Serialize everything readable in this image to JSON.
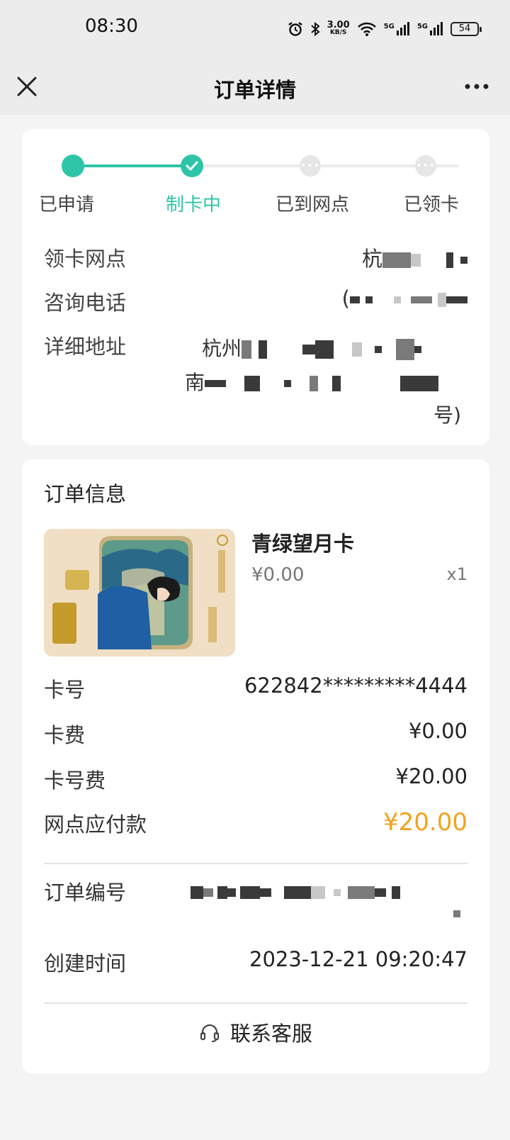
{
  "status": {
    "time": "08:30",
    "speed_value": "3.00",
    "speed_unit": "KB/S",
    "net1": "5G",
    "net2": "5G",
    "battery": "54"
  },
  "nav": {
    "title": "订单详情",
    "close_icon": "close-icon",
    "more_icon": "more-icon"
  },
  "progress": {
    "steps": [
      {
        "label": "已申请",
        "state": "done"
      },
      {
        "label": "制卡中",
        "state": "current"
      },
      {
        "label": "已到网点",
        "state": "pending"
      },
      {
        "label": "已领卡",
        "state": "pending"
      }
    ],
    "completed_fraction": 0.333,
    "accent": "#2ec4a7"
  },
  "branch": {
    "branch_label": "领卡网点",
    "branch_value_visible": "杭",
    "phone_label": "咨询电话",
    "phone_value_visible": "(",
    "address_label": "详细地址",
    "address_line1_visible": "杭州",
    "address_line2_visible": "南",
    "address_line3_visible": "号)"
  },
  "order": {
    "section_title": "订单信息",
    "product": {
      "name": "青绿望月卡",
      "price": "¥0.00",
      "qty": "x1"
    },
    "fees": [
      {
        "label": "卡号",
        "value": "622842*********4444"
      },
      {
        "label": "卡费",
        "value": "¥0.00"
      },
      {
        "label": "卡号费",
        "value": "¥20.00"
      }
    ],
    "pay_label": "网点应付款",
    "pay_value": "¥20.00",
    "pay_color": "#f3a21b",
    "order_no_label": "订单编号",
    "created_label": "创建时间",
    "created_value": "2023-12-21 09:20:47",
    "customer_service": "联系客服"
  }
}
